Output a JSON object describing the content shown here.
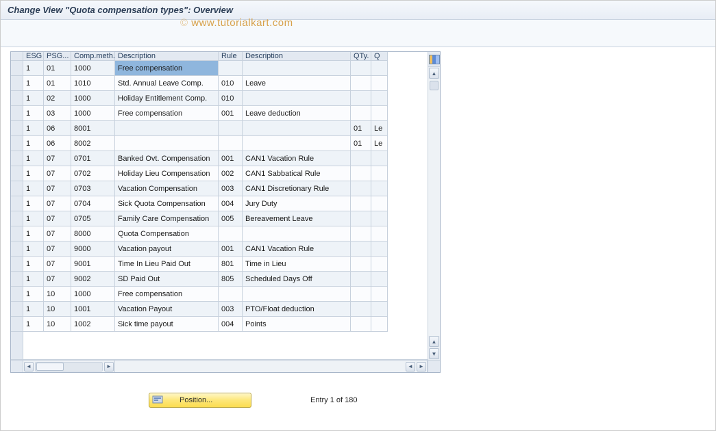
{
  "title": "Change View \"Quota compensation types\": Overview",
  "watermark": "www.tutorialkart.com",
  "columns": {
    "esg": "ESG",
    "psg": "PSG...",
    "comp": "Comp.meth.",
    "desc1": "Description",
    "rule": "Rule",
    "desc2": "Description",
    "qty": "QTy.",
    "q": "Q"
  },
  "rows": [
    {
      "esg": "1",
      "psg": "01",
      "comp": "1000",
      "desc1": "Free compensation",
      "rule": "",
      "desc2": "",
      "qty": "",
      "q": "",
      "sel": true
    },
    {
      "esg": "1",
      "psg": "01",
      "comp": "1010",
      "desc1": "Std. Annual Leave Comp.",
      "rule": "010",
      "desc2": "Leave",
      "qty": "",
      "q": ""
    },
    {
      "esg": "1",
      "psg": "02",
      "comp": "1000",
      "desc1": "Holiday Entitlement Comp.",
      "rule": "010",
      "desc2": "",
      "qty": "",
      "q": ""
    },
    {
      "esg": "1",
      "psg": "03",
      "comp": "1000",
      "desc1": "Free compensation",
      "rule": "001",
      "desc2": "Leave deduction",
      "qty": "",
      "q": ""
    },
    {
      "esg": "1",
      "psg": "06",
      "comp": "8001",
      "desc1": "",
      "rule": "",
      "desc2": "",
      "qty": "01",
      "q": "Le"
    },
    {
      "esg": "1",
      "psg": "06",
      "comp": "8002",
      "desc1": "",
      "rule": "",
      "desc2": "",
      "qty": "01",
      "q": "Le"
    },
    {
      "esg": "1",
      "psg": "07",
      "comp": "0701",
      "desc1": "Banked Ovt. Compensation",
      "rule": "001",
      "desc2": "CAN1 Vacation Rule",
      "qty": "",
      "q": ""
    },
    {
      "esg": "1",
      "psg": "07",
      "comp": "0702",
      "desc1": "Holiday Lieu Compensation",
      "rule": "002",
      "desc2": "CAN1 Sabbatical Rule",
      "qty": "",
      "q": ""
    },
    {
      "esg": "1",
      "psg": "07",
      "comp": "0703",
      "desc1": "Vacation Compensation",
      "rule": "003",
      "desc2": "CAN1 Discretionary Rule",
      "qty": "",
      "q": ""
    },
    {
      "esg": "1",
      "psg": "07",
      "comp": "0704",
      "desc1": "Sick Quota Compensation",
      "rule": "004",
      "desc2": "Jury Duty",
      "qty": "",
      "q": ""
    },
    {
      "esg": "1",
      "psg": "07",
      "comp": "0705",
      "desc1": "Family Care Compensation",
      "rule": "005",
      "desc2": "Bereavement Leave",
      "qty": "",
      "q": ""
    },
    {
      "esg": "1",
      "psg": "07",
      "comp": "8000",
      "desc1": "Quota Compensation",
      "rule": "",
      "desc2": "",
      "qty": "",
      "q": ""
    },
    {
      "esg": "1",
      "psg": "07",
      "comp": "9000",
      "desc1": "Vacation payout",
      "rule": "001",
      "desc2": "CAN1 Vacation Rule",
      "qty": "",
      "q": ""
    },
    {
      "esg": "1",
      "psg": "07",
      "comp": "9001",
      "desc1": "Time In Lieu Paid Out",
      "rule": "801",
      "desc2": "Time in Lieu",
      "qty": "",
      "q": ""
    },
    {
      "esg": "1",
      "psg": "07",
      "comp": "9002",
      "desc1": "SD Paid Out",
      "rule": "805",
      "desc2": "Scheduled Days Off",
      "qty": "",
      "q": ""
    },
    {
      "esg": "1",
      "psg": "10",
      "comp": "1000",
      "desc1": "Free compensation",
      "rule": "",
      "desc2": "",
      "qty": "",
      "q": ""
    },
    {
      "esg": "1",
      "psg": "10",
      "comp": "1001",
      "desc1": "Vacation Payout",
      "rule": "003",
      "desc2": "PTO/Float deduction",
      "qty": "",
      "q": ""
    },
    {
      "esg": "1",
      "psg": "10",
      "comp": "1002",
      "desc1": "Sick time payout",
      "rule": "004",
      "desc2": "Points",
      "qty": "",
      "q": ""
    }
  ],
  "footer": {
    "position_label": "Position...",
    "entry_text": "Entry 1 of 180"
  },
  "icons": {
    "corner": "table-config-icon",
    "scroll_up": "▲",
    "scroll_down": "▼",
    "scroll_left": "◄",
    "scroll_right": "►"
  }
}
